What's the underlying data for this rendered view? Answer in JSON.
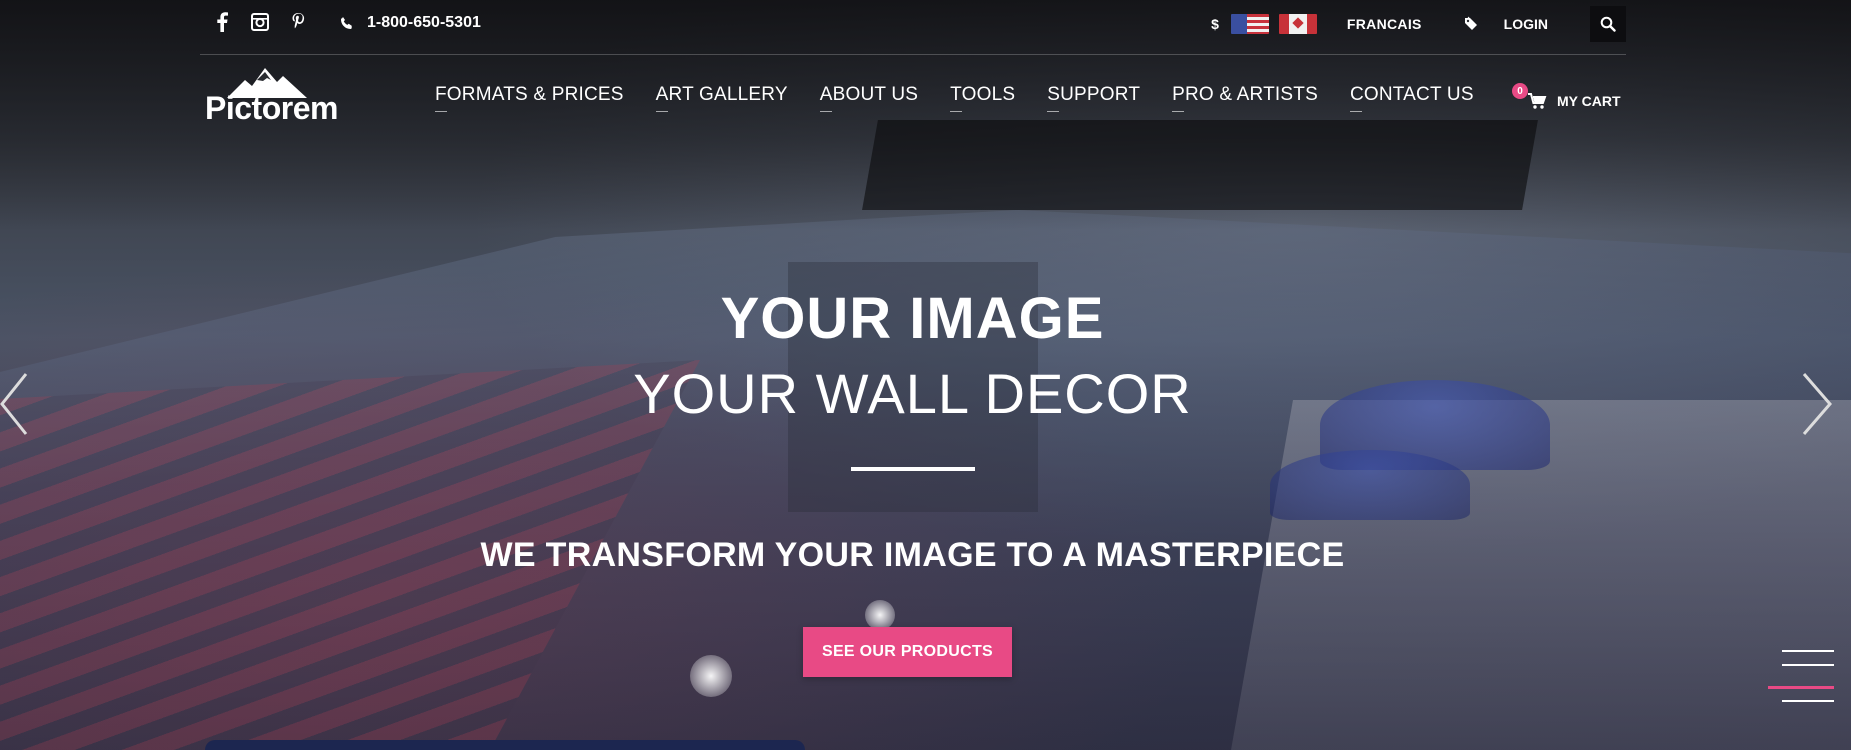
{
  "topbar": {
    "phone": "1-800-650-5301",
    "currency_symbol": "$",
    "language": "FRANCAIS",
    "login": "LOGIN"
  },
  "logo": {
    "text": "Pictorem"
  },
  "nav": {
    "items": [
      "FORMATS & PRICES",
      "ART GALLERY",
      "ABOUT US",
      "TOOLS",
      "SUPPORT",
      "PRO & ARTISTS",
      "CONTACT US"
    ]
  },
  "cart": {
    "count": "0",
    "label": "MY CART"
  },
  "hero": {
    "headline": "YOUR IMAGE",
    "subheadline": "YOUR WALL DECOR",
    "tagline": "WE TRANSFORM YOUR IMAGE TO A MASTERPIECE",
    "cta": "SEE OUR PRODUCTS"
  },
  "colors": {
    "accent": "#e84a85",
    "search_bg": "#0d0d10"
  },
  "icons": {
    "social": [
      "facebook-icon",
      "instagram-icon",
      "pinterest-icon"
    ],
    "phone": "phone-icon",
    "tag": "tag-icon",
    "search": "search-icon",
    "cart": "cart-icon",
    "prev": "chevron-left-icon",
    "next": "chevron-right-icon",
    "menu": "hamburger-menu-icon"
  }
}
